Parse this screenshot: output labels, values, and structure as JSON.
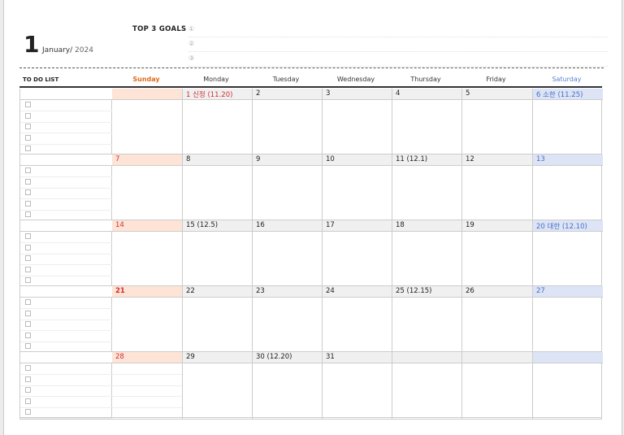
{
  "header": {
    "month_number": "1",
    "month_name": "January/",
    "year": "2024",
    "goals_title": "TOP 3 GOALS",
    "goal_markers": [
      "①",
      "②",
      "③"
    ]
  },
  "todo_label": "TO DO LIST",
  "day_names": [
    {
      "label": "Sunday",
      "color": "#e06a1b"
    },
    {
      "label": "Monday",
      "color": "#333333"
    },
    {
      "label": "Tuesday",
      "color": "#333333"
    },
    {
      "label": "Wednesday",
      "color": "#333333"
    },
    {
      "label": "Thursday",
      "color": "#333333"
    },
    {
      "label": "Friday",
      "color": "#333333"
    },
    {
      "label": "Saturday",
      "color": "#5b7fd1"
    }
  ],
  "weeks": [
    [
      "",
      "1 신정 (11.20)",
      "2",
      "3",
      "4",
      "5",
      "6 소한 (11.25)"
    ],
    [
      "7",
      "8",
      "9",
      "10",
      "11 (12.1)",
      "12",
      "13"
    ],
    [
      "14",
      "15 (12.5)",
      "16",
      "17",
      "18",
      "19",
      "20 대한 (12.10)"
    ],
    [
      "21",
      "22",
      "23",
      "24",
      "25 (12.15)",
      "26",
      "27"
    ],
    [
      "28",
      "29",
      "30 (12.20)",
      "31",
      "",
      "",
      ""
    ]
  ],
  "colors": {
    "sunday_bg": "#fde4d6",
    "saturday_bg": "#dce4f5",
    "weekday_bg": "#f0f0f0",
    "holiday_red": "#d32f2f",
    "saturday_blue": "#4a6fc9"
  }
}
